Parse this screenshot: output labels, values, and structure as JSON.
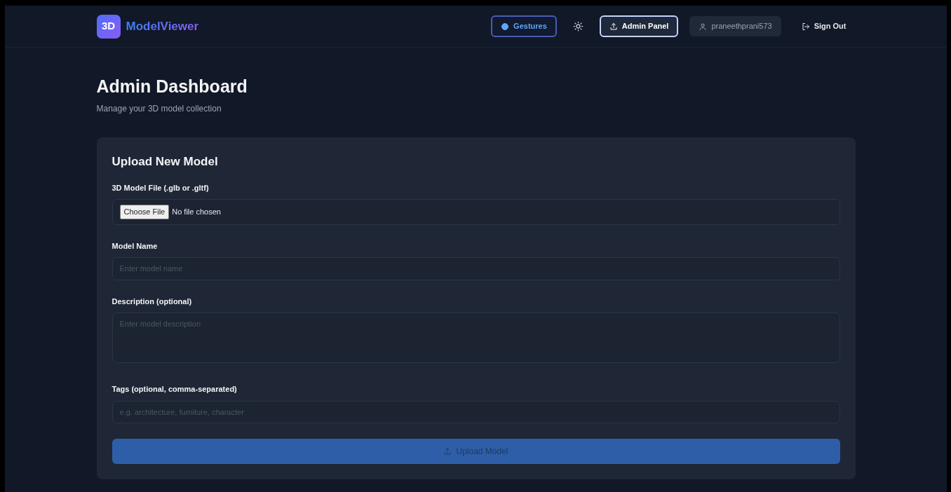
{
  "brand": {
    "logo": "3D",
    "name": "ModelViewer"
  },
  "nav": [
    {
      "kind": "outline",
      "label": "Gestures",
      "selected": false
    },
    {
      "kind": "icon"
    },
    {
      "kind": "outline",
      "label": "Admin Panel",
      "selected": true
    },
    {
      "kind": "user",
      "label": "praneethprani573"
    },
    {
      "kind": "plain",
      "label": "Sign Out"
    }
  ],
  "header": {
    "title": "Admin Dashboard",
    "subtitle": "Manage your 3D model collection"
  },
  "form": {
    "title": "Upload New Model",
    "fields": [
      {
        "kind": "file",
        "label": "3D Model File (.glb or .gltf)",
        "button": "Choose File",
        "value": "No file chosen"
      },
      {
        "kind": "text",
        "label": "Model Name",
        "placeholder": "Enter model name"
      },
      {
        "kind": "textarea",
        "label": "Description (optional)",
        "placeholder": "Enter model description"
      },
      {
        "kind": "text",
        "label": "Tags (optional, comma-separated)",
        "placeholder": "e.g. architecture, furniture, character"
      }
    ],
    "submit": {
      "label": "Upload Model",
      "disabled": true
    }
  }
}
